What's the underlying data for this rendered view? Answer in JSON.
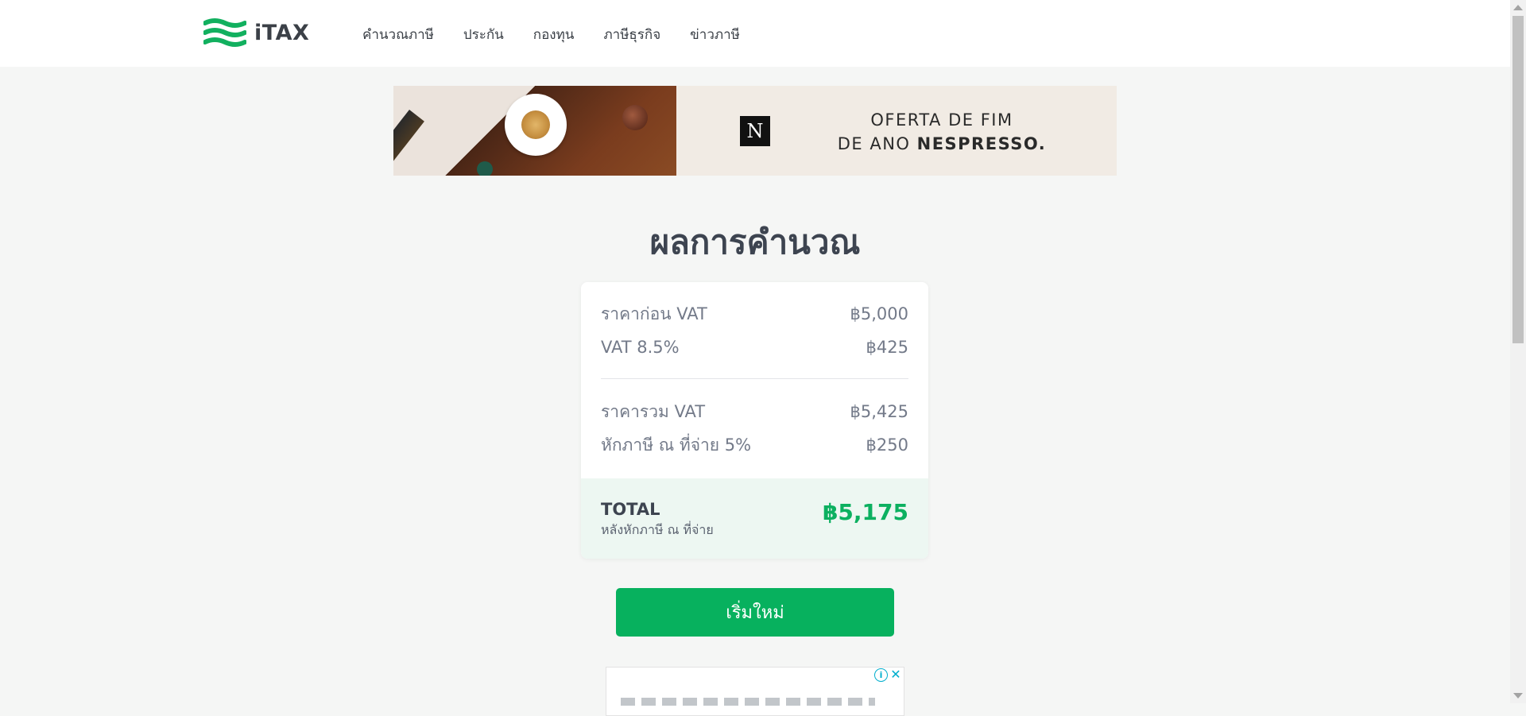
{
  "header": {
    "logo_text": "iTAX",
    "nav": [
      {
        "label": "คำนวณภาษี"
      },
      {
        "label": "ประกัน"
      },
      {
        "label": "กองทุน"
      },
      {
        "label": "ภาษีธุรกิจ"
      },
      {
        "label": "ข่าวภาษี"
      }
    ]
  },
  "banner": {
    "brand_mark": "N",
    "line1": "OFERTA DE FIM",
    "line2_prefix": "DE ANO ",
    "line2_brand": "NESPRESSO."
  },
  "result": {
    "title": "ผลการคำนวณ",
    "rows": [
      {
        "label": "ราคาก่อน VAT",
        "value": "฿5,000"
      },
      {
        "label": "VAT 8.5%",
        "value": "฿425"
      },
      {
        "label": "ราคารวม VAT",
        "value": "฿5,425"
      },
      {
        "label": "หักภาษี ณ ที่จ่าย 5%",
        "value": "฿250"
      }
    ],
    "total": {
      "label": "TOTAL",
      "sublabel": "หลังหักภาษี ณ ที่จ่าย",
      "value": "฿5,175"
    }
  },
  "restart_label": "เริ่มใหม่",
  "ad": {
    "info_glyph": "i",
    "close_glyph": "✕"
  },
  "colors": {
    "accent": "#07b15e",
    "total_value": "#0cb060",
    "total_bg": "#edf7f2",
    "page_bg": "#f5f6f5"
  }
}
